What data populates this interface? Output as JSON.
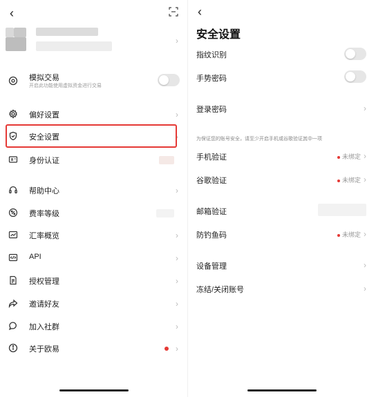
{
  "left": {
    "trade_sim": {
      "title": "模拟交易",
      "subtitle": "开启此功能使用虚拟资金进行交易"
    },
    "menu": [
      {
        "label": "偏好设置",
        "icon": "gear-icon"
      },
      {
        "label": "安全设置",
        "icon": "shield-icon"
      },
      {
        "label": "身份认证",
        "icon": "id-card-icon"
      },
      {
        "label": "帮助中心",
        "icon": "headset-icon"
      },
      {
        "label": "费率等级",
        "icon": "percent-icon"
      },
      {
        "label": "汇率概览",
        "icon": "chart-icon"
      },
      {
        "label": "API",
        "icon": "code-icon"
      },
      {
        "label": "授权管理",
        "icon": "document-icon"
      },
      {
        "label": "邀请好友",
        "icon": "share-icon"
      },
      {
        "label": "加入社群",
        "icon": "chat-icon"
      },
      {
        "label": "关于欧易",
        "icon": "info-icon"
      }
    ]
  },
  "right": {
    "title": "安全设置",
    "fingerprint": "指纹识别",
    "gesture": "手势密码",
    "login_password": "登录密码",
    "note": "为保证您的账号安全，请至少开启手机或谷歌验证其中一项",
    "phone_verify": "手机验证",
    "google_verify": "谷歌验证",
    "email_verify": "邮箱验证",
    "anti_phishing": "防钓鱼码",
    "device_manage": "设备管理",
    "freeze": "冻结/关闭账号",
    "unbound": "未绑定"
  },
  "colors": {
    "highlight": "#e53935",
    "badge": "#e53935"
  }
}
